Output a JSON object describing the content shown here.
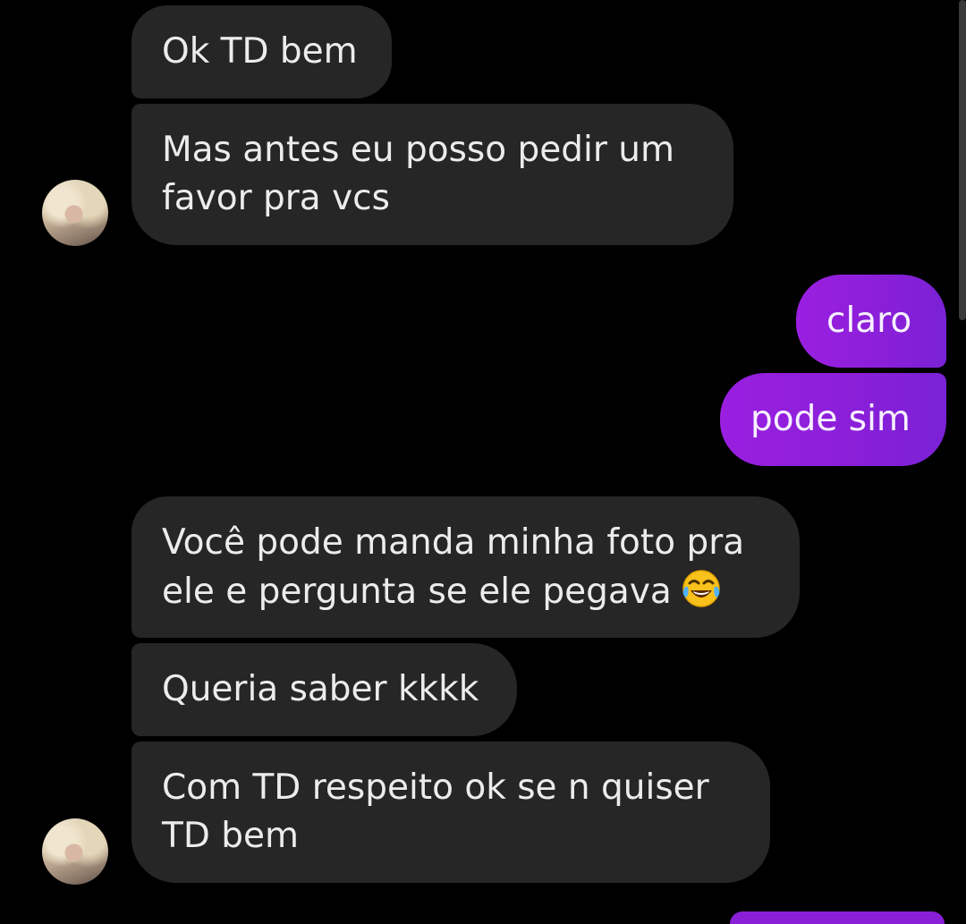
{
  "conversation": {
    "messages": [
      {
        "direction": "incoming",
        "lines": [
          "Ok TD bem"
        ]
      },
      {
        "direction": "incoming",
        "lines": [
          "Mas antes eu posso pedir um",
          "favor pra vcs"
        ]
      },
      {
        "direction": "outgoing",
        "lines": [
          "claro"
        ]
      },
      {
        "direction": "outgoing",
        "lines": [
          "pode sim"
        ]
      },
      {
        "direction": "incoming",
        "lines": [
          "Você pode manda minha foto pra",
          "ele e pergunta se ele pegava"
        ],
        "trailing_emoji": "face-with-tears-of-joy-icon"
      },
      {
        "direction": "incoming",
        "lines": [
          "Queria saber kkkk"
        ]
      },
      {
        "direction": "incoming",
        "lines": [
          "Com TD respeito ok se n quiser",
          "TD bem"
        ]
      }
    ]
  },
  "colors": {
    "background": "#000000",
    "incoming_bubble": "#262626",
    "outgoing_bubble": "#8a1fd8",
    "text": "#ececec"
  }
}
